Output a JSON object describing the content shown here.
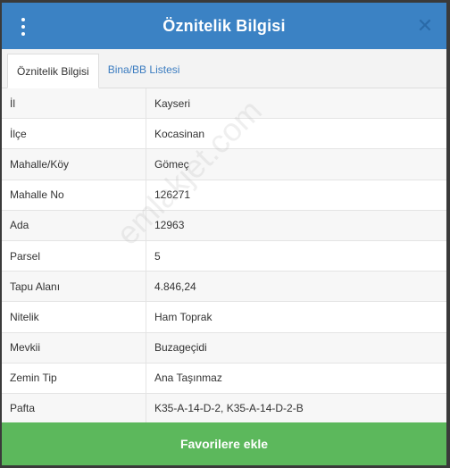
{
  "header": {
    "title": "Öznitelik Bilgisi",
    "menu_icon": "kebab-menu-icon",
    "close_icon": "close-icon",
    "close_glyph": "✕"
  },
  "tabs": [
    {
      "label": "Öznitelik Bilgisi",
      "active": true
    },
    {
      "label": "Bina/BB Listesi",
      "active": false
    }
  ],
  "rows": [
    {
      "label": "İl",
      "value": "Kayseri"
    },
    {
      "label": "İlçe",
      "value": "Kocasinan"
    },
    {
      "label": "Mahalle/Köy",
      "value": "Gömeç"
    },
    {
      "label": "Mahalle No",
      "value": "126271"
    },
    {
      "label": "Ada",
      "value": "12963"
    },
    {
      "label": "Parsel",
      "value": "5"
    },
    {
      "label": "Tapu Alanı",
      "value": "4.846,24"
    },
    {
      "label": "Nitelik",
      "value": "Ham Toprak"
    },
    {
      "label": "Mevkii",
      "value": "Buzageçidi"
    },
    {
      "label": "Zemin Tip",
      "value": "Ana Taşınmaz"
    },
    {
      "label": "Pafta",
      "value": "K35-A-14-D-2, K35-A-14-D-2-B"
    }
  ],
  "watermark": "emlakjet.com",
  "footer": {
    "button_label": "Favorilere ekle"
  },
  "colors": {
    "header": "#3b82c4",
    "footer": "#5cb85c",
    "tab_link": "#3b7cc0"
  }
}
